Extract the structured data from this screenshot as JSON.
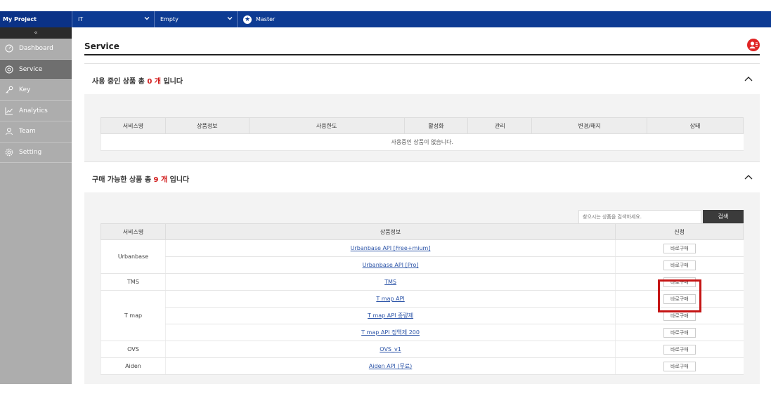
{
  "topbar": {
    "project": "My Project",
    "select1": "iT",
    "select2": "Empty",
    "role": "Master"
  },
  "sidebar": {
    "collapse": "«",
    "items": [
      {
        "label": "Dashboard",
        "icon": "dashboard-icon"
      },
      {
        "label": "Service",
        "icon": "service-icon",
        "active": true
      },
      {
        "label": "Key",
        "icon": "key-icon"
      },
      {
        "label": "Analytics",
        "icon": "analytics-icon"
      },
      {
        "label": "Team",
        "icon": "team-icon"
      },
      {
        "label": "Setting",
        "icon": "gear-icon"
      }
    ]
  },
  "page": {
    "title": "Service"
  },
  "in_use": {
    "heading_prefix": "사용 중인 상품 총",
    "count": "0 개",
    "heading_suffix": "입니다",
    "columns": [
      "서비스명",
      "상품정보",
      "사용한도",
      "활성화",
      "관리",
      "변경/해지",
      "상태"
    ],
    "empty_message": "사용중인 상품이 없습니다."
  },
  "available": {
    "heading_prefix": "구매 가능한 상품 총",
    "count": "9 개",
    "heading_suffix": "입니다",
    "search_placeholder": "찾으시는 상품을 검색하세요.",
    "search_button": "검색",
    "columns": [
      "서비스명",
      "상품정보",
      "신청"
    ],
    "buy_label": "바로구매",
    "services": [
      "Urbanbase",
      "TMS",
      "T map",
      "OVS",
      "Aiden"
    ],
    "products": [
      "Urbanbase API [Free+mium]",
      "Urbanbase API [Pro]",
      "TMS",
      "T map API",
      "T map API 종량제",
      "T map API 정액제 200",
      "OVS_v1",
      "Aiden API (무료)"
    ]
  },
  "colors": {
    "topbar": "#0d3b93",
    "accent": "#d11a1a",
    "sidebar": "#adadad"
  }
}
